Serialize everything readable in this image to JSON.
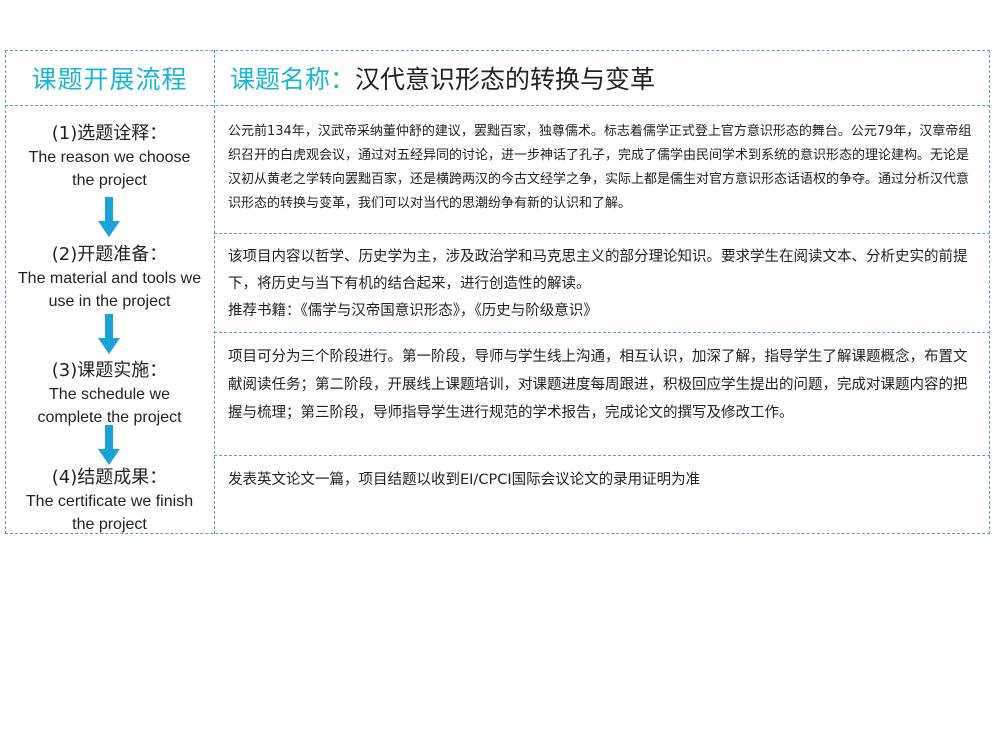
{
  "header": {
    "left_title": "课题开展流程",
    "right_label": "课题名称：",
    "right_title": "汉代意识形态的转换与变革"
  },
  "steps": [
    {
      "title": "(1)选题诠释：",
      "english": [
        "The reason we choose",
        "the project"
      ]
    },
    {
      "title": "(2)开题准备：",
      "english": [
        "The material and tools we",
        "use in the project"
      ]
    },
    {
      "title": "(3)课题实施：",
      "english": [
        "The schedule we",
        "complete the project"
      ]
    },
    {
      "title": "(4)结题成果：",
      "english": [
        "The certificate we finish",
        "the project"
      ]
    }
  ],
  "contents": {
    "interpretation": "公元前134年，汉武帝采纳董仲舒的建议，罢黜百家，独尊儒术。标志着儒学正式登上官方意识形态的舞台。公元79年，汉章帝组织召开的白虎观会议，通过对五经异同的讨论，进一步神话了孔子，完成了儒学由民间学术到系统的意识形态的理论建构。无论是汉初从黄老之学转向罢黜百家，还是横跨两汉的今古文经学之争，实际上都是儒生对官方意识形态话语权的争夺。通过分析汉代意识形态的转换与变革，我们可以对当代的思潮纷争有新的认识和了解。",
    "preparation": "该项目内容以哲学、历史学为主，涉及政治学和马克思主义的部分理论知识。要求学生在阅读文本、分析史实的前提下，将历史与当下有机的结合起来，进行创造性的解读。",
    "books": "推荐书籍：《儒学与汉帝国意识形态》，《历史与阶级意识》",
    "implementation": "项目可分为三个阶段进行。第一阶段，导师与学生线上沟通，相互认识，加深了解，指导学生了解课题概念，布置文献阅读任务；第二阶段，开展线上课题培训，对课题进度每周跟进，积极回应学生提出的问题，完成对课题内容的把握与梳理；第三阶段，导师指导学生进行规范的学术报告，完成论文的撰写及修改工作。",
    "result": "发表英文论文一篇，项目结题以收到EI/CPCI国际会议论文的录用证明为准"
  },
  "colors": {
    "accent": "#1cb5d3",
    "border": "#5b9bd5",
    "arrow": "#1aa3d9"
  }
}
